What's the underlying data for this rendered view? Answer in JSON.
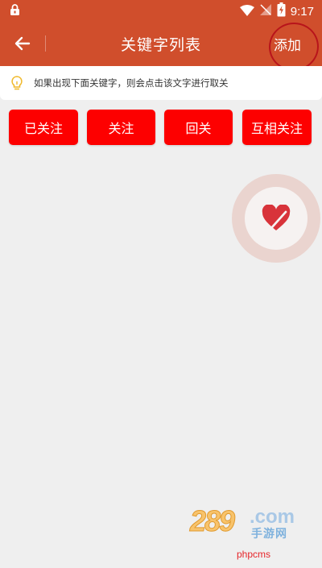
{
  "status_bar": {
    "time": "9:17",
    "icons": [
      "lock-icon",
      "wifi-icon",
      "no-signal-icon",
      "battery-charging-icon"
    ]
  },
  "app_bar": {
    "title": "关键字列表",
    "add_label": "添加",
    "back_icon": "arrow-left-icon",
    "accent_color": "#d04e2c"
  },
  "tip": {
    "icon": "lightbulb-icon",
    "text": "如果出现下面关键字，则会点击该文字进行取关"
  },
  "filters": {
    "buttons": [
      {
        "label": "已关注"
      },
      {
        "label": "关注"
      },
      {
        "label": "回关"
      },
      {
        "label": "互相关注"
      }
    ],
    "button_color": "#fd0000"
  },
  "floating_button": {
    "icon": "heart-slash-icon"
  },
  "watermark": {
    "digits": "289",
    "suffix": ".com",
    "subtitle": "手游网",
    "caption": "phpcms"
  }
}
